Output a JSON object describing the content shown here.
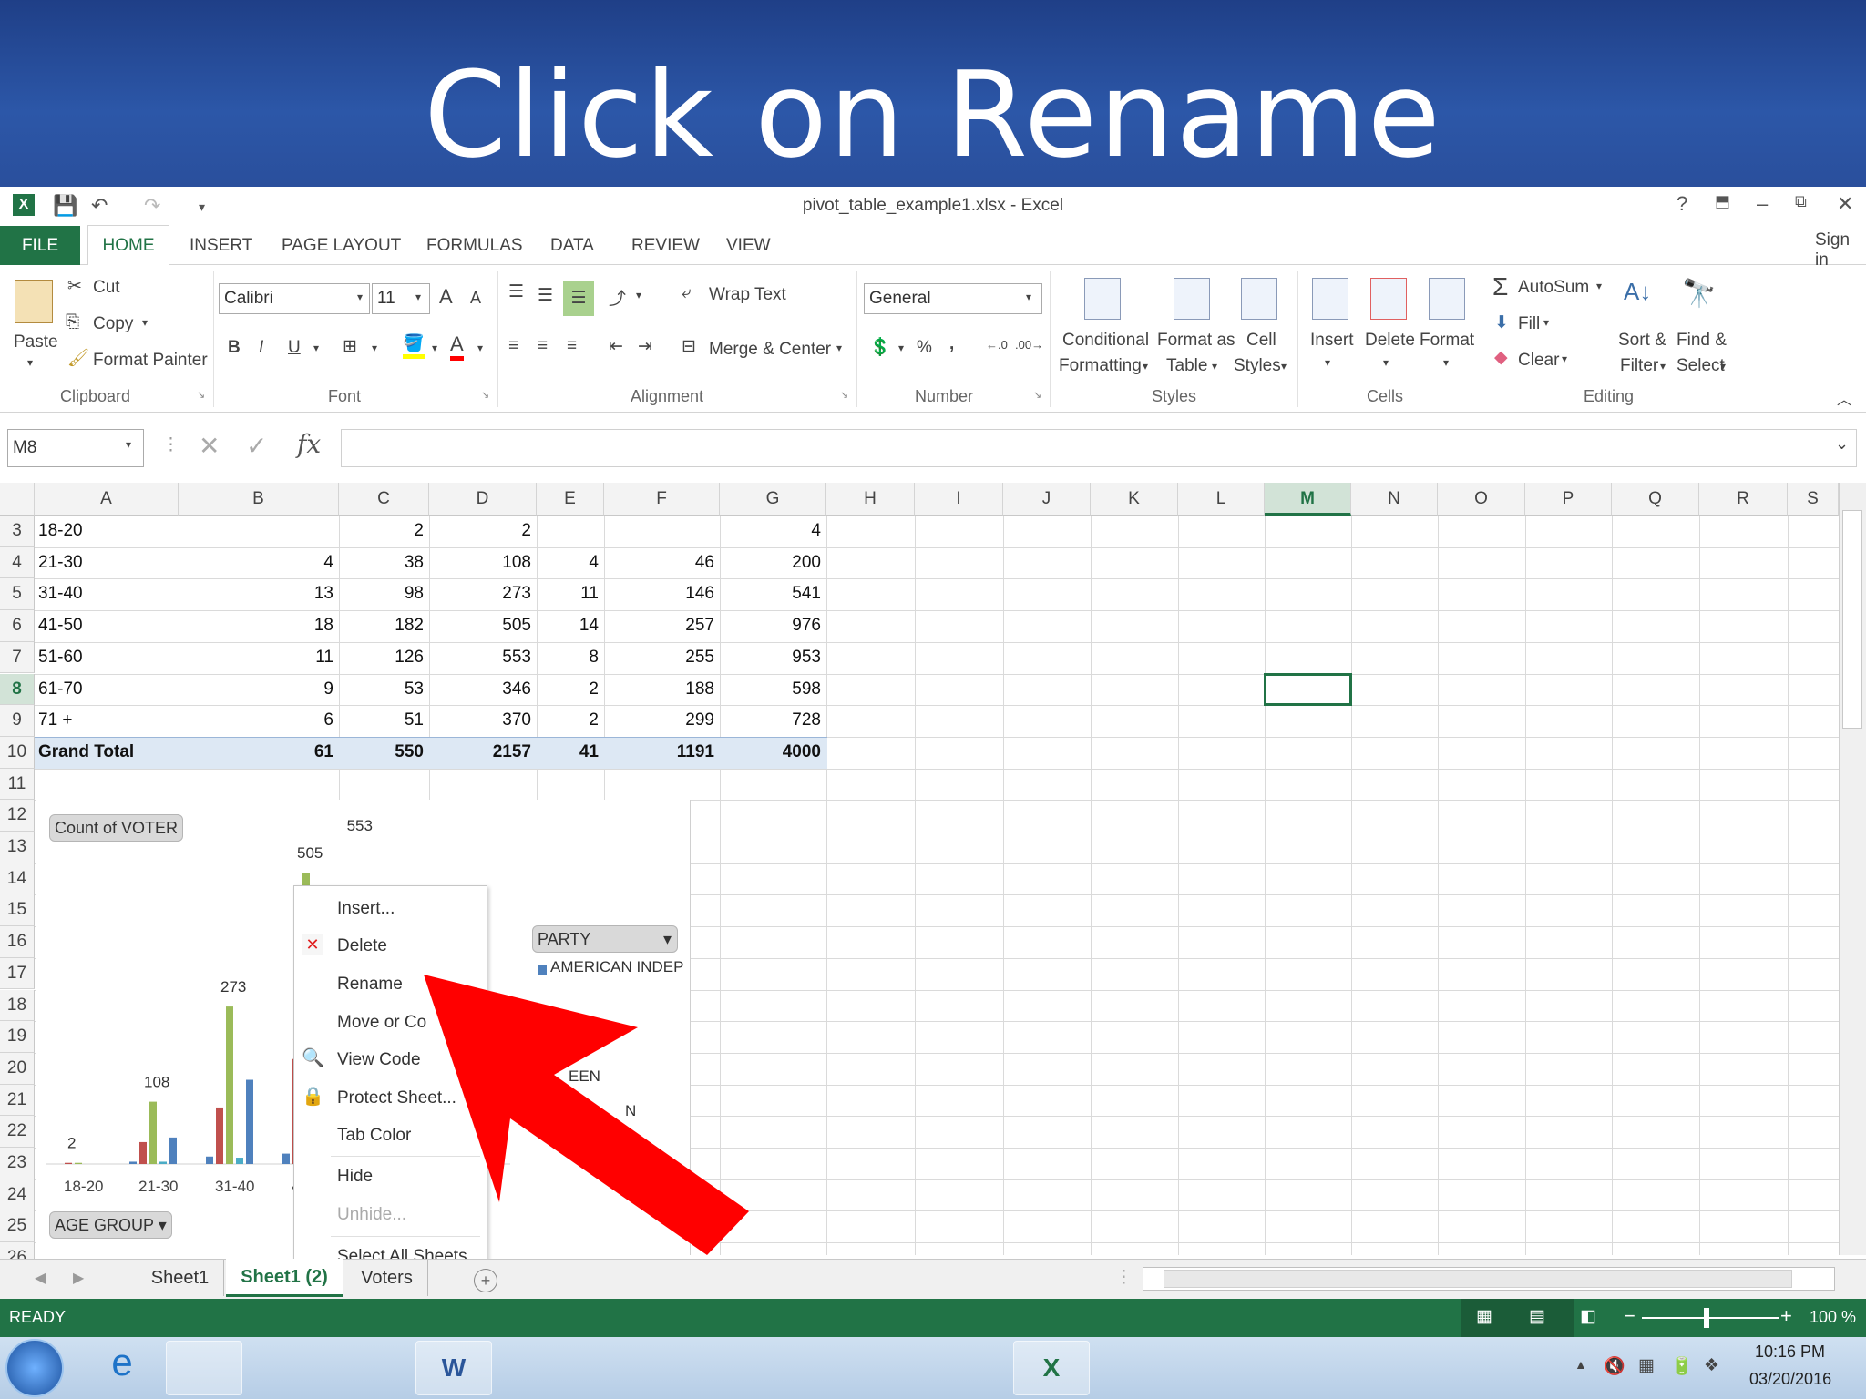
{
  "banner": {
    "title": "Click on Rename"
  },
  "window": {
    "title": "pivot_table_example1.xlsx - Excel",
    "sign_in": "Sign in",
    "help": "?",
    "minimize": "–",
    "restore": "⧉",
    "close": "✕"
  },
  "tabs": [
    "FILE",
    "HOME",
    "INSERT",
    "PAGE LAYOUT",
    "FORMULAS",
    "DATA",
    "REVIEW",
    "VIEW"
  ],
  "ribbon": {
    "clipboard": {
      "paste": "Paste",
      "cut": "Cut",
      "copy": "Copy",
      "format_painter": "Format Painter",
      "group": "Clipboard"
    },
    "font": {
      "name": "Calibri",
      "size": "11",
      "group": "Font",
      "bold": "B",
      "italic": "I",
      "underline": "U",
      "grow": "A",
      "shrink": "A"
    },
    "alignment": {
      "wrap_text": "Wrap Text",
      "merge_center": "Merge & Center",
      "group": "Alignment"
    },
    "number": {
      "format": "General",
      "percent": "%",
      "comma": ",",
      "group": "Number"
    },
    "styles": {
      "conditional_1": "Conditional",
      "conditional_2": "Formatting",
      "format_table_1": "Format as",
      "format_table_2": "Table",
      "cell_styles_1": "Cell",
      "cell_styles_2": "Styles",
      "group": "Styles"
    },
    "cells": {
      "insert": "Insert",
      "delete": "Delete",
      "format": "Format",
      "group": "Cells"
    },
    "editing": {
      "autosum": "AutoSum",
      "fill": "Fill",
      "clear": "Clear",
      "sort_1": "Sort &",
      "sort_2": "Filter",
      "find_1": "Find &",
      "find_2": "Select",
      "group": "Editing"
    }
  },
  "formula_bar": {
    "name_box": "M8",
    "fx": "fx",
    "value": ""
  },
  "columns": [
    "A",
    "B",
    "C",
    "D",
    "E",
    "F",
    "G",
    "H",
    "I",
    "J",
    "K",
    "L",
    "M",
    "N",
    "O",
    "P",
    "Q",
    "R",
    "S"
  ],
  "rows": [
    "3",
    "4",
    "5",
    "6",
    "7",
    "8",
    "9",
    "10",
    "11",
    "12",
    "13",
    "14",
    "15",
    "16",
    "17",
    "18",
    "19",
    "20",
    "21",
    "22",
    "23",
    "24",
    "25",
    "26"
  ],
  "table": [
    [
      "18-20",
      "",
      "2",
      "2",
      "",
      "",
      "4"
    ],
    [
      "21-30",
      "4",
      "38",
      "108",
      "4",
      "46",
      "200"
    ],
    [
      "31-40",
      "13",
      "98",
      "273",
      "11",
      "146",
      "541"
    ],
    [
      "41-50",
      "18",
      "182",
      "505",
      "14",
      "257",
      "976"
    ],
    [
      "51-60",
      "11",
      "126",
      "553",
      "8",
      "255",
      "953"
    ],
    [
      "61-70",
      "9",
      "53",
      "346",
      "2",
      "188",
      "598"
    ],
    [
      "71 +",
      "6",
      "51",
      "370",
      "2",
      "299",
      "728"
    ],
    [
      "Grand Total",
      "61",
      "550",
      "2157",
      "41",
      "1191",
      "4000"
    ]
  ],
  "chart": {
    "count_button": "Count of VOTER",
    "age_group_button": "AGE GROUP",
    "party_button": "PARTY",
    "legend_first": "AMERICAN INDEP",
    "legend_partial_1": "EEN",
    "legend_partial_2": "N",
    "categories": [
      "18-20",
      "21-30",
      "31-40",
      "41-5"
    ],
    "labels": {
      "l18": "2",
      "l21": "108",
      "l31": "273",
      "l41": "505",
      "l51": "553"
    },
    "colors": {
      "blue": "#4f81bd",
      "red": "#c0504d",
      "green": "#9bbb59",
      "teal": "#4bacc6"
    }
  },
  "chart_data": {
    "type": "bar",
    "title": "",
    "categories": [
      "18-20",
      "21-30",
      "31-40",
      "41-50"
    ],
    "series": [
      {
        "name": "AMERICAN INDEP",
        "values": [
          0,
          4,
          13,
          18
        ]
      },
      {
        "values": [
          2,
          38,
          98,
          182
        ]
      },
      {
        "values": [
          2,
          108,
          273,
          505
        ]
      },
      {
        "values": [
          0,
          4,
          11,
          14
        ]
      },
      {
        "values": [
          0,
          46,
          146,
          257
        ]
      }
    ],
    "ylim": [
      0,
      600
    ],
    "grid": false
  },
  "context_menu": [
    "Insert...",
    "Delete",
    "Rename",
    "Move or Copy...",
    "View Code",
    "Protect Sheet...",
    "Tab Color",
    "Hide",
    "Unhide...",
    "Select All Sheets"
  ],
  "context_menu_visible": {
    "move": "Move or Co",
    "protect": "Protect Sheet..."
  },
  "sheets": [
    "Sheet1",
    "Sheet1 (2)",
    "Voters"
  ],
  "status": {
    "ready": "READY",
    "zoom": "100 %"
  },
  "taskbar": {
    "time": "10:16 PM",
    "date": "03/20/2016"
  },
  "annotation": {
    "arrow_color": "#ff0000"
  }
}
